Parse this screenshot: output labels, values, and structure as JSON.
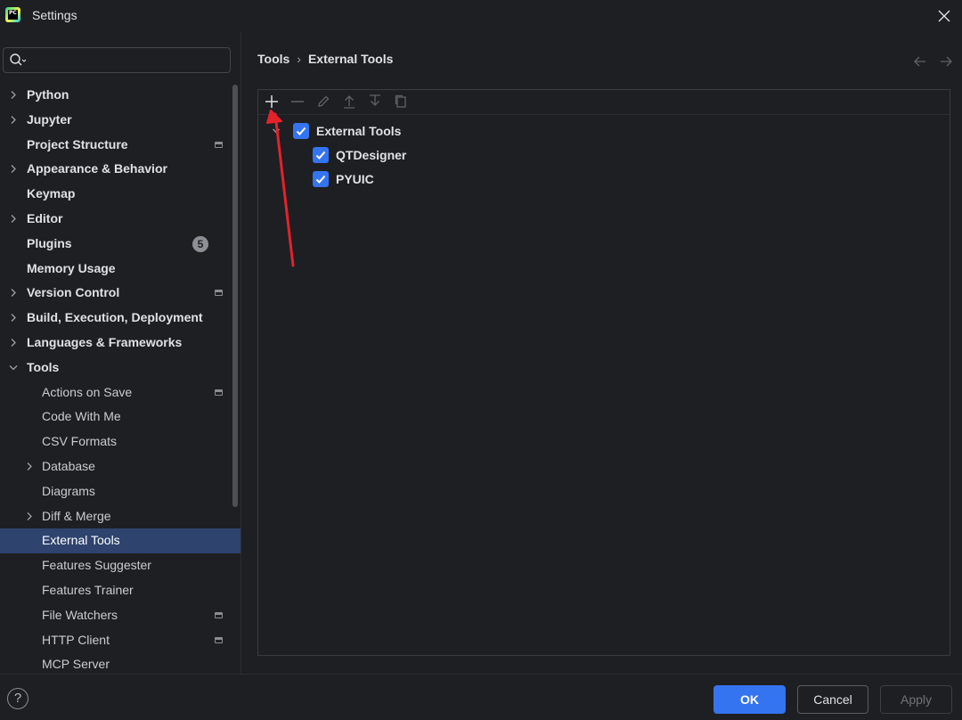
{
  "window": {
    "title": "Settings",
    "app_icon_text": "PC"
  },
  "search": {
    "placeholder": "",
    "value": ""
  },
  "sidebar": {
    "items": [
      {
        "label": "Python",
        "level": 0,
        "expandable": true,
        "expanded": false
      },
      {
        "label": "Jupyter",
        "level": 0,
        "expandable": true,
        "expanded": false
      },
      {
        "label": "Project Structure",
        "level": 0,
        "expandable": false,
        "project_marker": true
      },
      {
        "label": "Appearance & Behavior",
        "level": 0,
        "expandable": true,
        "expanded": false
      },
      {
        "label": "Keymap",
        "level": 0,
        "expandable": false
      },
      {
        "label": "Editor",
        "level": 0,
        "expandable": true,
        "expanded": false
      },
      {
        "label": "Plugins",
        "level": 0,
        "expandable": false,
        "badge": "5"
      },
      {
        "label": "Memory Usage",
        "level": 0,
        "expandable": false
      },
      {
        "label": "Version Control",
        "level": 0,
        "expandable": true,
        "expanded": false,
        "project_marker": true
      },
      {
        "label": "Build, Execution, Deployment",
        "level": 0,
        "expandable": true,
        "expanded": false
      },
      {
        "label": "Languages & Frameworks",
        "level": 0,
        "expandable": true,
        "expanded": false
      },
      {
        "label": "Tools",
        "level": 0,
        "expandable": true,
        "expanded": true
      },
      {
        "label": "Actions on Save",
        "level": 1,
        "expandable": false,
        "project_marker": true
      },
      {
        "label": "Code With Me",
        "level": 1,
        "expandable": false
      },
      {
        "label": "CSV Formats",
        "level": 1,
        "expandable": false
      },
      {
        "label": "Database",
        "level": 1,
        "expandable": true,
        "expanded": false
      },
      {
        "label": "Diagrams",
        "level": 1,
        "expandable": false
      },
      {
        "label": "Diff & Merge",
        "level": 1,
        "expandable": true,
        "expanded": false
      },
      {
        "label": "External Tools",
        "level": 1,
        "expandable": false,
        "selected": true
      },
      {
        "label": "Features Suggester",
        "level": 1,
        "expandable": false
      },
      {
        "label": "Features Trainer",
        "level": 1,
        "expandable": false
      },
      {
        "label": "File Watchers",
        "level": 1,
        "expandable": false,
        "project_marker": true
      },
      {
        "label": "HTTP Client",
        "level": 1,
        "expandable": false,
        "project_marker": true
      },
      {
        "label": "MCP Server",
        "level": 1,
        "expandable": false
      }
    ]
  },
  "breadcrumb": {
    "parent": "Tools",
    "separator": "›",
    "current": "External Tools"
  },
  "toolbar": {
    "buttons": [
      {
        "name": "add-icon",
        "enabled": true
      },
      {
        "name": "remove-icon",
        "enabled": false
      },
      {
        "name": "edit-icon",
        "enabled": false
      },
      {
        "name": "move-up-icon",
        "enabled": false
      },
      {
        "name": "move-down-icon",
        "enabled": false
      },
      {
        "name": "copy-icon",
        "enabled": false
      }
    ]
  },
  "tools_tree": {
    "group": {
      "label": "External Tools",
      "checked": true,
      "expanded": true
    },
    "items": [
      {
        "label": "QTDesigner",
        "checked": true
      },
      {
        "label": "PYUIC",
        "checked": true
      }
    ]
  },
  "footer": {
    "help_label": "?",
    "ok_label": "OK",
    "cancel_label": "Cancel",
    "apply_label": "Apply"
  },
  "colors": {
    "accent": "#3574f0",
    "selection": "#2e436e",
    "background": "#1e1f22",
    "annotation_arrow": "#e5222b"
  }
}
